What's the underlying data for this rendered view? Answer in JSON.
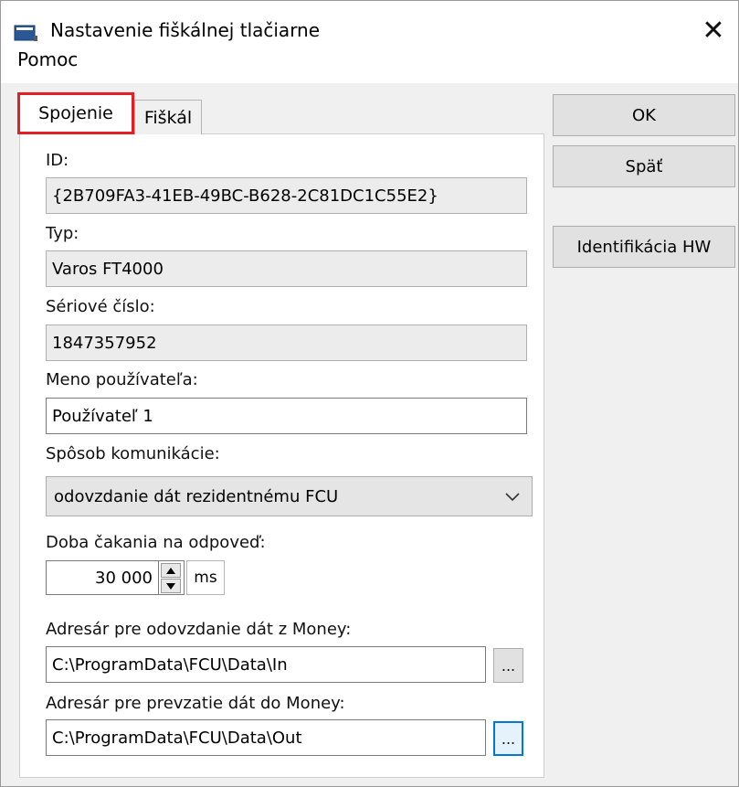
{
  "window": {
    "title": "Nastavenie fiškálnej tlačiarne",
    "app_icon": "window-app-icon",
    "close_icon": "close-icon"
  },
  "menu": {
    "help": "Pomoc"
  },
  "tabs": [
    {
      "label": "Spojenie",
      "active": true
    },
    {
      "label": "Fiškál",
      "active": false
    }
  ],
  "form": {
    "id_label": "ID:",
    "id_value": "{2B709FA3-41EB-49BC-B628-2C81DC1C55E2}",
    "type_label": "Typ:",
    "type_value": "Varos FT4000",
    "serial_label": "Sériové číslo:",
    "serial_value": "1847357952",
    "user_label": "Meno používateľa:",
    "user_value": "Používateľ 1",
    "comm_label": "Spôsob komunikácie:",
    "comm_value": "odovzdanie dát rezidentnému FCU",
    "timeout_label": "Doba čakania na odpoveď:",
    "timeout_value": "30 000",
    "timeout_unit": "ms",
    "out_dir_label": "Adresár pre odovzdanie dát z Money:",
    "out_dir_value": "C:\\ProgramData\\FCU\\Data\\In",
    "in_dir_label": "Adresár pre prevzatie dát do Money:",
    "in_dir_value": "C:\\ProgramData\\FCU\\Data\\Out",
    "browse_label": "..."
  },
  "buttons": {
    "ok": "OK",
    "back": "Späť",
    "hw_id": "Identifikácia HW"
  },
  "colors": {
    "highlight": "#e31e24",
    "focus": "#0078d7"
  }
}
